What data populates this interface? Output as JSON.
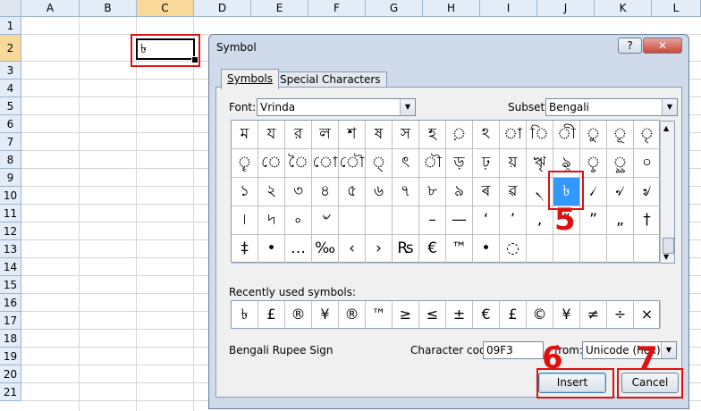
{
  "spreadsheet": {
    "columns": [
      "A",
      "B",
      "C",
      "D",
      "E",
      "F",
      "G",
      "H",
      "I",
      "J",
      "K",
      "L"
    ],
    "rows": [
      "1",
      "2",
      "3",
      "4",
      "5",
      "6",
      "7",
      "8",
      "9",
      "10",
      "11",
      "12",
      "13",
      "14",
      "15",
      "16",
      "17",
      "18",
      "19",
      "20",
      "21"
    ],
    "selected_column": "C",
    "selected_row": "2",
    "active_cell_value": "৳"
  },
  "annotations": {
    "step5": "5",
    "step6": "6",
    "step7": "7"
  },
  "dialog": {
    "title": "Symbol",
    "help_button": "?",
    "close_button": "✕",
    "tabs": [
      "Symbols",
      "Special Characters"
    ],
    "font_label": "Font:",
    "font_value": "Vrinda",
    "subset_label": "Subset:",
    "subset_value": "Bengali",
    "symbol_rows": [
      [
        "ম",
        "য",
        "র",
        "ল",
        "শ",
        "ষ",
        "স",
        "হ",
        "়",
        "ঽ",
        "া",
        "ি",
        "ী",
        "ু",
        "ূ",
        "ৃ"
      ],
      [
        "ৄ",
        "ে",
        "ৈ",
        "ো",
        "ৌ",
        "্",
        "ৎ",
        "ৗ",
        "ড়",
        "ঢ়",
        "য়",
        "ৠ",
        "ৡ",
        "ৢ",
        "ৣ",
        "০"
      ],
      [
        "১",
        "২",
        "৩",
        "৪",
        "৫",
        "৬",
        "৭",
        "৮",
        "৯",
        "ৰ",
        "ৱ",
        "৲",
        "৳",
        "৴",
        "৵",
        "৶"
      ],
      [
        "৷",
        "৸",
        "৹",
        "৺",
        "",
        "",
        "",
        "–",
        "—",
        "‘",
        "’",
        "‚",
        "“",
        "”",
        "„",
        "†"
      ],
      [
        "‡",
        "•",
        "…",
        "‰",
        "‹",
        "›",
        "₨",
        "€",
        "™",
        "•",
        "◌",
        "",
        "",
        "",
        "",
        ""
      ]
    ],
    "selected_symbol": "৳",
    "recent_label": "Recently used symbols:",
    "recent_symbols": [
      "৳",
      "£",
      "®",
      "¥",
      "®",
      "™",
      "≥",
      "≤",
      "±",
      "€",
      "£",
      "©",
      "¥",
      "≠",
      "÷",
      "×"
    ],
    "char_name": "Bengali Rupee Sign",
    "char_code_label": "Character code:",
    "char_code_value": "09F3",
    "from_label": "from:",
    "from_value": "Unicode (hex)",
    "insert_button": "Insert",
    "cancel_button": "Cancel"
  },
  "colors": {
    "selection": "#3399ff",
    "annotation": "#e01010",
    "dialog_bg": "#cfdbea"
  }
}
